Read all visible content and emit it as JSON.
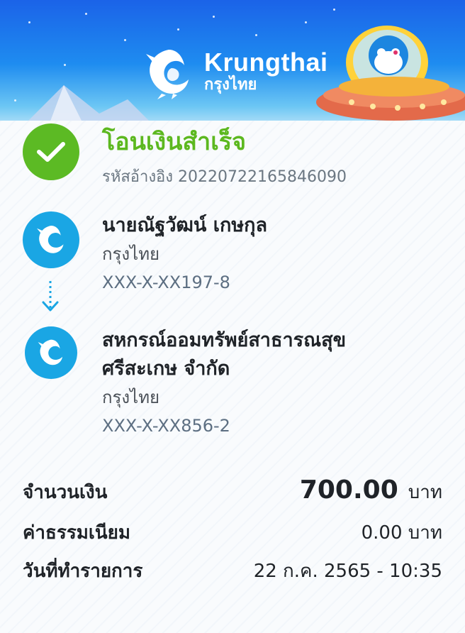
{
  "brand": {
    "name_en": "Krungthai",
    "name_th": "กรุงไทย"
  },
  "status": {
    "title": "โอนเงินสำเร็จ",
    "reference": "รหัสอ้างอิง 20220722165846090"
  },
  "sender": {
    "name": "นายณัฐวัฒน์ เกษกุล",
    "bank": "กรุงไทย",
    "account": "XXX-X-XX197-8"
  },
  "receiver": {
    "name_line1": "สหกรณ์ออมทรัพย์สาธารณสุข",
    "name_line2": "ศรีสะเกษ จำกัด",
    "bank": "กรุงไทย",
    "account": "XXX-X-XX856-2"
  },
  "details": {
    "amount_label": "จำนวนเงิน",
    "amount_value": "700.00",
    "amount_unit": "บาท",
    "fee_label": "ค่าธรรมเนียม",
    "fee_value": "0.00 บาท",
    "date_label": "วันที่ทำรายการ",
    "date_value": "22 ก.ค. 2565 - 10:35"
  },
  "colors": {
    "success": "#5cba24",
    "bank_blue": "#1aa6e4",
    "header_blue": "#1b63e8"
  }
}
